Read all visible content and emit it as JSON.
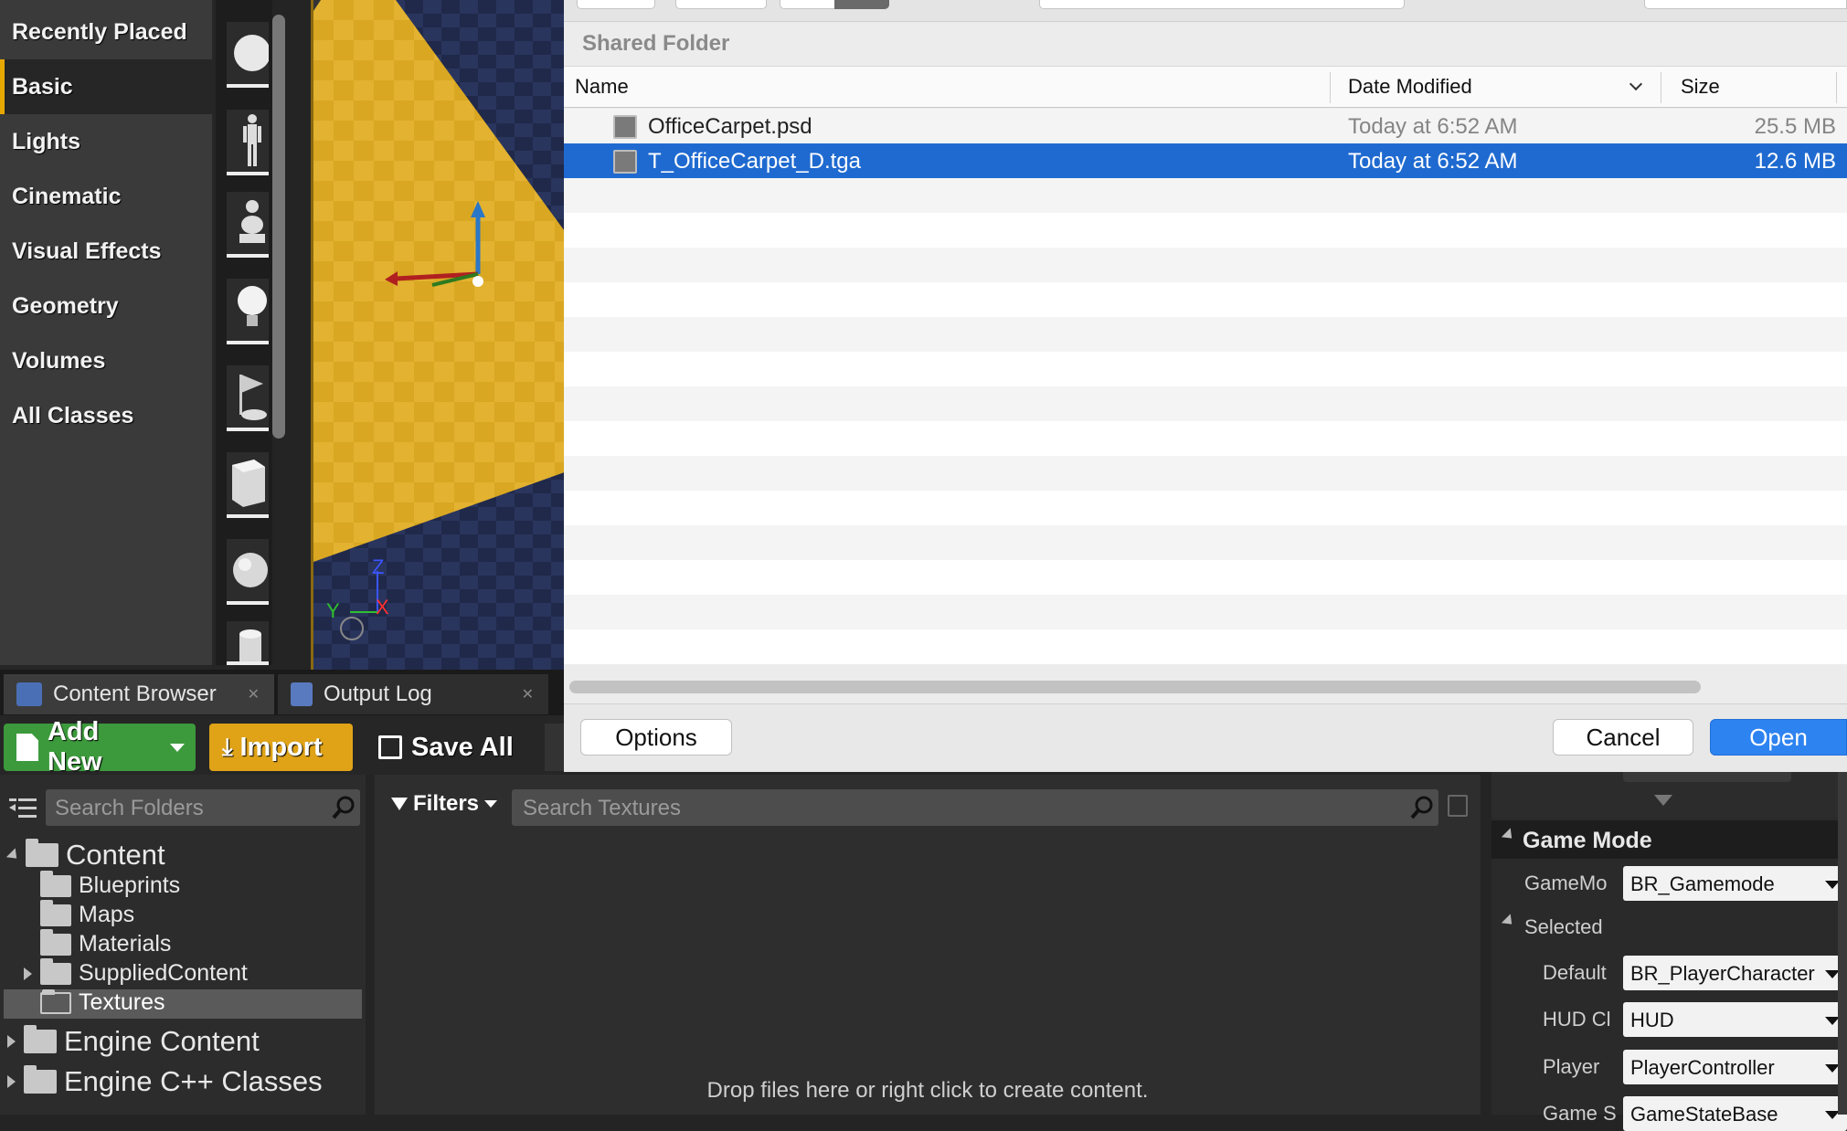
{
  "modes": {
    "categories": [
      "Recently Placed",
      "Basic",
      "Lights",
      "Cinematic",
      "Visual Effects",
      "Geometry",
      "Volumes",
      "All Classes"
    ],
    "selected": "Basic"
  },
  "dialog": {
    "folder_title": "Shared Folder",
    "columns": {
      "name": "Name",
      "date": "Date Modified",
      "size": "Size"
    },
    "files": [
      {
        "name": "OfficeCarpet.psd",
        "date": "Today at 6:52 AM",
        "size": "25.5 MB",
        "selected": false
      },
      {
        "name": "T_OfficeCarpet_D.tga",
        "date": "Today at 6:52 AM",
        "size": "12.6 MB",
        "selected": true
      }
    ],
    "options_label": "Options",
    "cancel_label": "Cancel",
    "open_label": "Open"
  },
  "viewport": {
    "axis_z": "Z",
    "axis_y": "Y",
    "axis_x": "X"
  },
  "tabs": [
    {
      "label": "Content Browser",
      "active": true
    },
    {
      "label": "Output Log",
      "active": false
    }
  ],
  "toolbar": {
    "add_new": "Add New",
    "import": "Import",
    "save_all": "Save All"
  },
  "folders": {
    "search_placeholder": "Search Folders",
    "content": "Content",
    "children": [
      "Blueprints",
      "Maps",
      "Materials",
      "SuppliedContent",
      "Textures"
    ],
    "selected": "Textures",
    "engine_content": "Engine Content",
    "engine_cpp": "Engine C++ Classes"
  },
  "assets": {
    "filters_label": "Filters",
    "search_placeholder": "Search Textures",
    "drop_text": "Drop files here or right click to create content."
  },
  "details": {
    "section": "Game Mode",
    "gamemode_label": "GameMo",
    "gamemode_value": "BR_Gamemode",
    "selected_label": "Selected",
    "fields": [
      {
        "label": "Default",
        "value": "BR_PlayerCharacter"
      },
      {
        "label": "HUD Cl",
        "value": "HUD"
      },
      {
        "label": "Player",
        "value": "PlayerController"
      },
      {
        "label": "Game S",
        "value": "GameStateBase"
      }
    ]
  }
}
